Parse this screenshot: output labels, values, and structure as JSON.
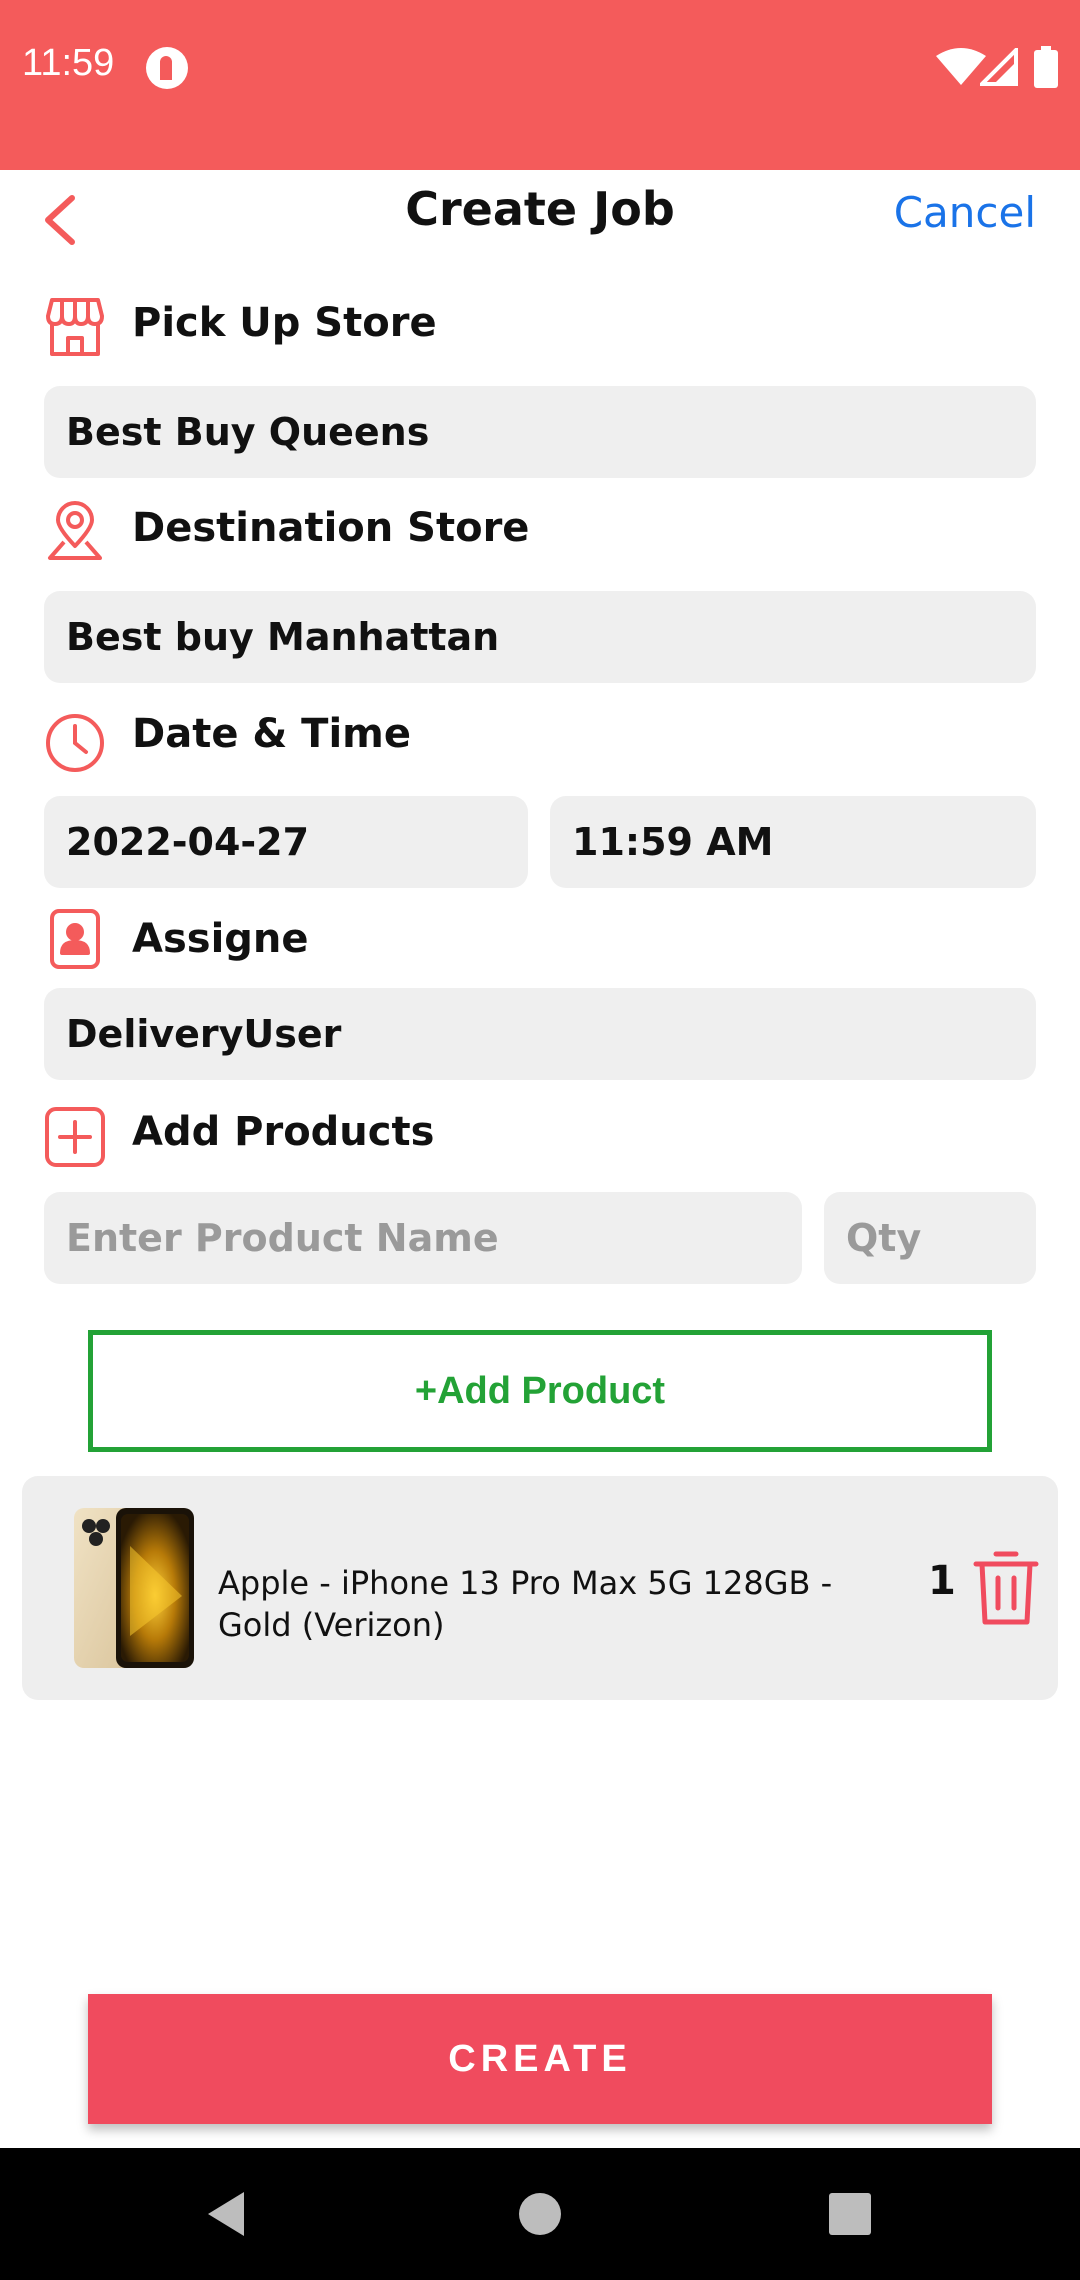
{
  "status_bar": {
    "time": "11:59"
  },
  "header": {
    "title": "Create Job",
    "cancel_label": "Cancel"
  },
  "pickup": {
    "label": "Pick Up Store",
    "value": "Best Buy Queens"
  },
  "destination": {
    "label": "Destination Store",
    "value": "Best buy Manhattan"
  },
  "datetime": {
    "label": "Date & Time",
    "date": "2022-04-27",
    "time": "11:59 AM"
  },
  "assignee": {
    "label": "Assigne",
    "value": "DeliveryUser"
  },
  "add_products": {
    "label": "Add Products",
    "name_placeholder": "Enter Product Name",
    "qty_placeholder": "Qty",
    "button_label": "+Add Product"
  },
  "products": [
    {
      "name": "Apple - iPhone 13 Pro Max 5G 128GB - Gold (Verizon)",
      "qty": "1"
    }
  ],
  "create_label": "CREATE",
  "colors": {
    "accent": "#f45b5b",
    "primary_button": "#f04b5e",
    "link": "#1a73e8",
    "add_button": "#23a236"
  }
}
